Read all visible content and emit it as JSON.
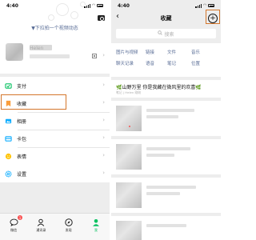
{
  "left": {
    "status_time": "4:40",
    "moment_hint": "▼下拉拍一个视频动态",
    "profile_name": "Helen",
    "menu_groups": [
      [
        {
          "label": "支付",
          "icon": "pay-icon",
          "color": "#07c160"
        }
      ],
      [
        {
          "label": "收藏",
          "icon": "favorites-icon",
          "color": "#fa9d3b"
        },
        {
          "label": "相册",
          "icon": "album-icon",
          "color": "#10aeff"
        },
        {
          "label": "卡包",
          "icon": "cards-icon",
          "color": "#10aeff"
        },
        {
          "label": "表情",
          "icon": "sticker-icon",
          "color": "#ffc300"
        }
      ],
      [
        {
          "label": "设置",
          "icon": "settings-icon",
          "color": "#10aeff"
        }
      ]
    ],
    "tabs": [
      {
        "label": "微信",
        "icon": "chat-icon",
        "badge": "1"
      },
      {
        "label": "通讯录",
        "icon": "contacts-icon"
      },
      {
        "label": "发现",
        "icon": "discover-icon"
      },
      {
        "label": "我",
        "icon": "me-icon",
        "active": true
      }
    ]
  },
  "right": {
    "status_time": "4:40",
    "title": "收藏",
    "search_placeholder": "搜索",
    "filters": [
      [
        "图片与视频",
        "链接",
        "文件",
        "音乐"
      ],
      [
        "聊天记录",
        "语音",
        "笔记",
        "位置"
      ]
    ],
    "note_title": "山野万里 你是我藏在微风里的欢喜",
    "note_meta": "笔记 | Helen  刚刚"
  },
  "colors": {
    "green": "#07c160",
    "link": "#576b95",
    "highlight": "#d4762b"
  }
}
